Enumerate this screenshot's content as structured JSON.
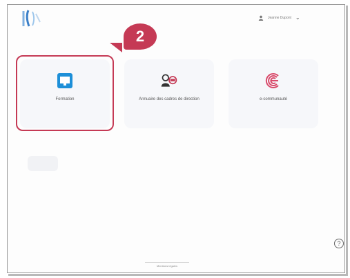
{
  "step_badge": "2",
  "user": {
    "name": "Jeanne Dupont",
    "icon": "user-icon"
  },
  "tiles": [
    {
      "label": "Formation",
      "icon": "monitor-icon",
      "color": "#1d8fd8"
    },
    {
      "label": "Annuaire des cadres de direction",
      "icon": "people-icon",
      "color": "#c53a55"
    },
    {
      "label": "e-communauté",
      "icon": "e-community-icon",
      "color": "#d94a6a"
    }
  ],
  "footer": {
    "link": "Mentions légales"
  },
  "help_label": "?",
  "colors": {
    "accent": "#c53a55",
    "brand_blue": "#1d8fd8"
  }
}
